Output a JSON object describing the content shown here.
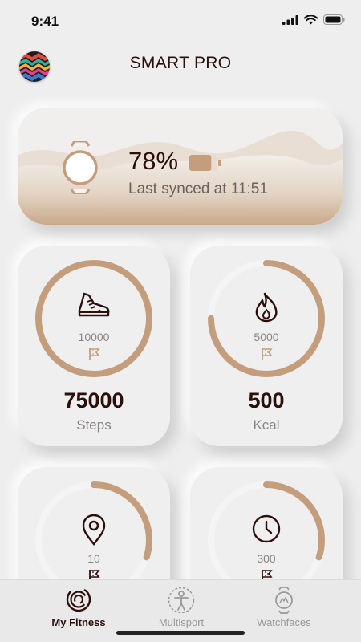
{
  "status_bar": {
    "time": "9:41"
  },
  "header": {
    "title": "SMART PRO"
  },
  "device": {
    "battery_percent": "78%",
    "battery_level": 0.78,
    "sync_status": "Last synced at 11:51"
  },
  "stats": [
    {
      "id": "steps",
      "goal": "10000",
      "value": "75000",
      "label": "Steps",
      "progress": 1.0,
      "icon": "sneaker-icon"
    },
    {
      "id": "kcal",
      "goal": "5000",
      "value": "500",
      "label": "Kcal",
      "progress": 0.75,
      "icon": "flame-icon"
    },
    {
      "id": "distance",
      "goal": "10",
      "value": "",
      "label": "",
      "progress": 0.3,
      "icon": "location-pin-icon"
    },
    {
      "id": "time",
      "goal": "300",
      "value": "",
      "label": "",
      "progress": 0.3,
      "icon": "clock-icon"
    }
  ],
  "tabs": [
    {
      "label": "My Fitness",
      "icon": "fitness-rings-icon",
      "active": true
    },
    {
      "label": "Multisport",
      "icon": "person-icon",
      "active": false
    },
    {
      "label": "Watchfaces",
      "icon": "watch-icon",
      "active": false
    }
  ],
  "colors": {
    "accent": "#c49e7c",
    "track": "#f4f4f4",
    "dark_text": "#2a0f0a",
    "muted_text": "#8a8482",
    "background": "#eeeeee"
  }
}
